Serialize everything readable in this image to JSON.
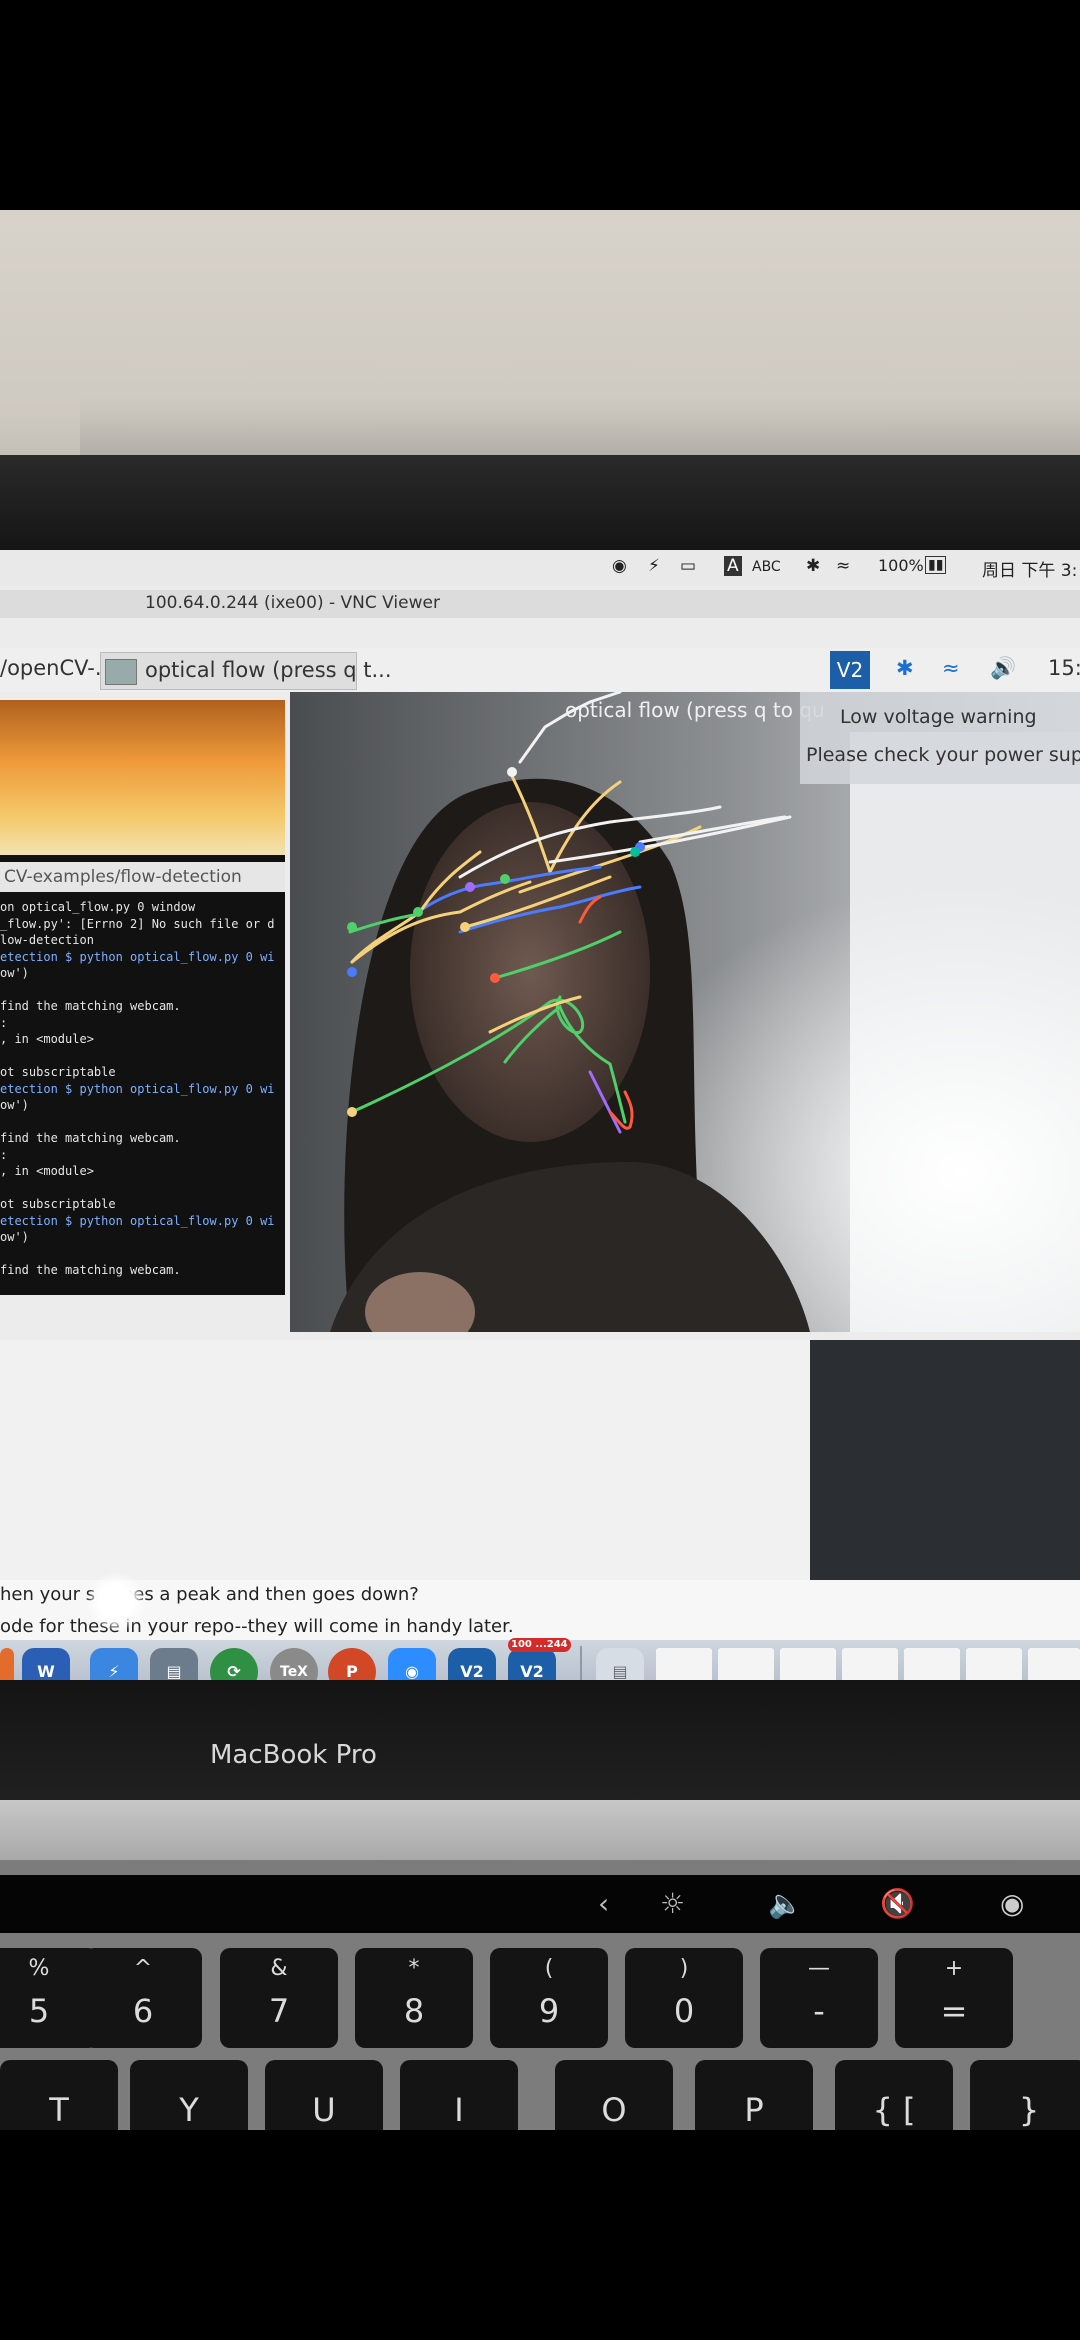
{
  "mac_menubar": {
    "input_label": "ABC",
    "battery": "100%",
    "datetime": "周日 下午 3:"
  },
  "vnc": {
    "window_title": "100.64.0.244 (ixe00) - VNC Viewer"
  },
  "pi_taskbar": {
    "left_path": "/openCV-...",
    "task_label": "optical flow (press q t...",
    "clock": "15:"
  },
  "terminal": {
    "path_bar": "CV-examples/flow-detection",
    "lines": [
      "on optical_flow.py 0 window",
      "_flow.py': [Errno 2] No such file or d",
      "low-detection",
      "etection $ python optical_flow.py 0 wi",
      "ow')",
      "",
      " find the matching webcam.",
      ":",
      ", in <module>",
      "",
      "ot subscriptable",
      "etection $ python optical_flow.py 0 wi",
      "ow')",
      "",
      " find the matching webcam.",
      ":",
      ", in <module>",
      "",
      "ot subscriptable",
      "etection $ python optical_flow.py 0 wi",
      "ow')",
      "",
      " find the matching webcam."
    ]
  },
  "video_window": {
    "title": "optical flow (press q to qu"
  },
  "notification": {
    "title": "Low voltage warning",
    "body": "Please check your power supp"
  },
  "page_text": {
    "line1": "hen your s        aches a peak and then goes down?",
    "line2": "ode for these in your repo--they will come in handy later."
  },
  "dock": {
    "badge": "100 ...244",
    "vnc_label": "V2"
  },
  "laptop": {
    "model": "MacBook Pro"
  },
  "keyboard": {
    "row1": [
      {
        "top": "%",
        "bottom": "5"
      },
      {
        "top": "^",
        "bottom": "6"
      },
      {
        "top": "&",
        "bottom": "7"
      },
      {
        "top": "*",
        "bottom": "8"
      },
      {
        "top": "(",
        "bottom": "9"
      },
      {
        "top": ")",
        "bottom": "0"
      },
      {
        "top": "—",
        "bottom": "-"
      },
      {
        "top": "+",
        "bottom": "="
      }
    ],
    "row2": [
      "T",
      "Y",
      "U",
      "I",
      "O",
      "P",
      "{ [",
      "}"
    ]
  },
  "colors": {
    "flow_green": "#4fd06a",
    "flow_blue": "#4a7cff",
    "flow_yellow": "#f5d27a",
    "flow_white": "#f2f2f2",
    "flow_red": "#ff5a3c"
  }
}
